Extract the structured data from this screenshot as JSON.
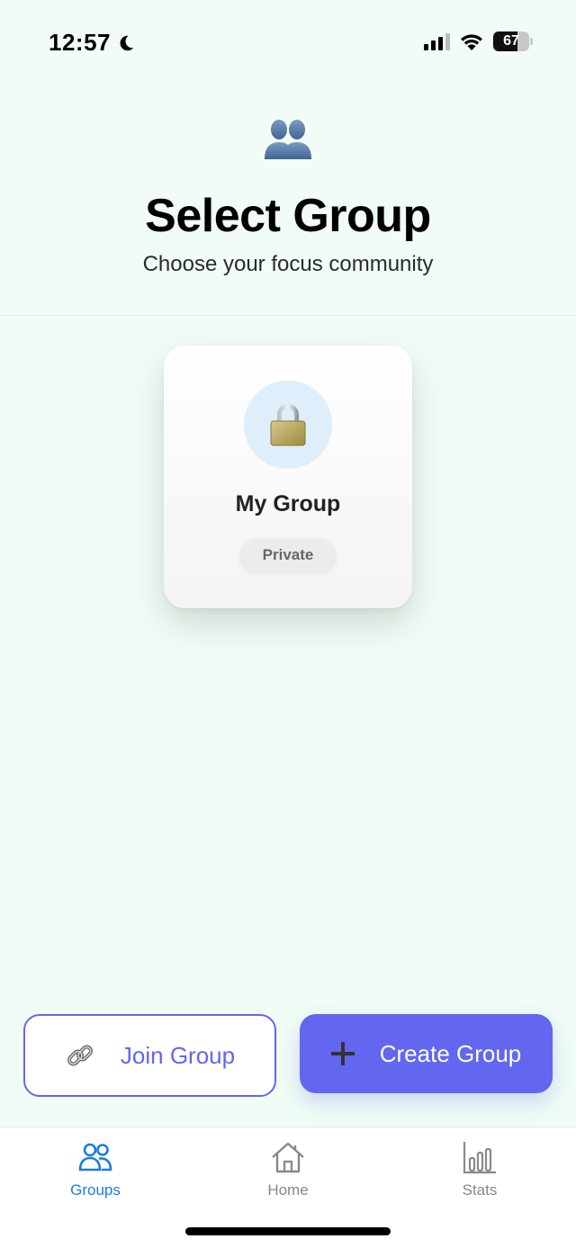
{
  "status_bar": {
    "time": "12:57",
    "battery": "67",
    "battery_level": 0.67,
    "icons": [
      "moon-icon",
      "cellular-signal-icon",
      "wifi-icon",
      "battery-icon"
    ]
  },
  "header": {
    "icon": "two-people-icon",
    "title": "Select Group",
    "subtitle": "Choose your focus community"
  },
  "groups": [
    {
      "name": "My Group",
      "privacy": "Private",
      "icon": "lock-icon"
    }
  ],
  "actions": {
    "join": {
      "label": "Join Group",
      "icon": "link-icon"
    },
    "create": {
      "label": "Create Group",
      "icon": "plus-icon"
    }
  },
  "tabs": [
    {
      "label": "Groups",
      "icon": "groups-icon",
      "active": true
    },
    {
      "label": "Home",
      "icon": "home-icon",
      "active": false
    },
    {
      "label": "Stats",
      "icon": "bar-chart-icon",
      "active": false
    }
  ],
  "colors": {
    "background": "#f0fcf5",
    "accent": "#6366f1",
    "tab_active": "#1a7de0"
  }
}
